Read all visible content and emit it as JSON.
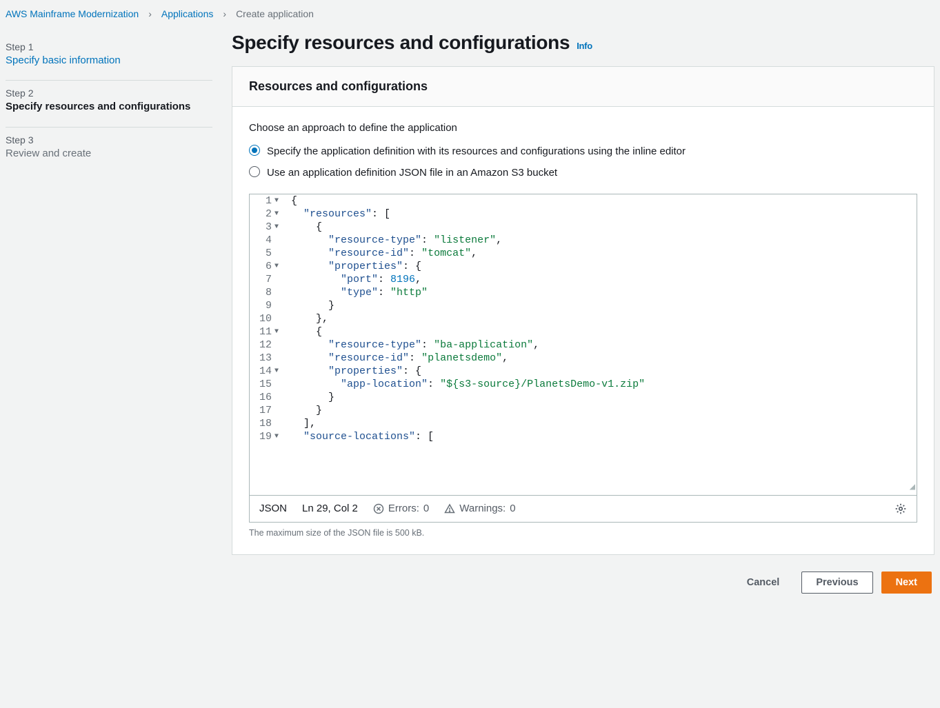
{
  "breadcrumb": {
    "items": [
      {
        "label": "AWS Mainframe Modernization",
        "link": true
      },
      {
        "label": "Applications",
        "link": true
      },
      {
        "label": "Create application",
        "link": false
      }
    ]
  },
  "sidebar": {
    "steps": [
      {
        "num": "Step 1",
        "title": "Specify basic information",
        "state": "link"
      },
      {
        "num": "Step 2",
        "title": "Specify resources and configurations",
        "state": "current"
      },
      {
        "num": "Step 3",
        "title": "Review and create",
        "state": "muted"
      }
    ]
  },
  "header": {
    "title": "Specify resources and configurations",
    "info": "Info"
  },
  "card": {
    "title": "Resources and configurations",
    "subhead": "Choose an approach to define the application",
    "option1": "Specify the application definition with its resources and configurations using the inline editor",
    "option2": "Use an application definition JSON file in an Amazon S3 bucket"
  },
  "editor": {
    "lines": [
      {
        "n": 1,
        "fold": true,
        "indent": 0,
        "tokens": [
          {
            "t": "punc",
            "v": "{"
          }
        ]
      },
      {
        "n": 2,
        "fold": true,
        "indent": 1,
        "tokens": [
          {
            "t": "key",
            "v": "\"resources\""
          },
          {
            "t": "punc",
            "v": ": ["
          }
        ]
      },
      {
        "n": 3,
        "fold": true,
        "indent": 2,
        "tokens": [
          {
            "t": "punc",
            "v": "{"
          }
        ]
      },
      {
        "n": 4,
        "fold": false,
        "indent": 3,
        "tokens": [
          {
            "t": "key",
            "v": "\"resource-type\""
          },
          {
            "t": "punc",
            "v": ": "
          },
          {
            "t": "str",
            "v": "\"listener\""
          },
          {
            "t": "punc",
            "v": ","
          }
        ]
      },
      {
        "n": 5,
        "fold": false,
        "indent": 3,
        "tokens": [
          {
            "t": "key",
            "v": "\"resource-id\""
          },
          {
            "t": "punc",
            "v": ": "
          },
          {
            "t": "str",
            "v": "\"tomcat\""
          },
          {
            "t": "punc",
            "v": ","
          }
        ]
      },
      {
        "n": 6,
        "fold": true,
        "indent": 3,
        "tokens": [
          {
            "t": "key",
            "v": "\"properties\""
          },
          {
            "t": "punc",
            "v": ": {"
          }
        ]
      },
      {
        "n": 7,
        "fold": false,
        "indent": 4,
        "tokens": [
          {
            "t": "key",
            "v": "\"port\""
          },
          {
            "t": "punc",
            "v": ": "
          },
          {
            "t": "num",
            "v": "8196"
          },
          {
            "t": "punc",
            "v": ","
          }
        ]
      },
      {
        "n": 8,
        "fold": false,
        "indent": 4,
        "tokens": [
          {
            "t": "key",
            "v": "\"type\""
          },
          {
            "t": "punc",
            "v": ": "
          },
          {
            "t": "str",
            "v": "\"http\""
          }
        ]
      },
      {
        "n": 9,
        "fold": false,
        "indent": 3,
        "tokens": [
          {
            "t": "punc",
            "v": "}"
          }
        ]
      },
      {
        "n": 10,
        "fold": false,
        "indent": 2,
        "tokens": [
          {
            "t": "punc",
            "v": "},"
          }
        ]
      },
      {
        "n": 11,
        "fold": true,
        "indent": 2,
        "tokens": [
          {
            "t": "punc",
            "v": "{"
          }
        ]
      },
      {
        "n": 12,
        "fold": false,
        "indent": 3,
        "tokens": [
          {
            "t": "key",
            "v": "\"resource-type\""
          },
          {
            "t": "punc",
            "v": ": "
          },
          {
            "t": "str",
            "v": "\"ba-application\""
          },
          {
            "t": "punc",
            "v": ","
          }
        ]
      },
      {
        "n": 13,
        "fold": false,
        "indent": 3,
        "tokens": [
          {
            "t": "key",
            "v": "\"resource-id\""
          },
          {
            "t": "punc",
            "v": ": "
          },
          {
            "t": "str",
            "v": "\"planetsdemo\""
          },
          {
            "t": "punc",
            "v": ","
          }
        ]
      },
      {
        "n": 14,
        "fold": true,
        "indent": 3,
        "tokens": [
          {
            "t": "key",
            "v": "\"properties\""
          },
          {
            "t": "punc",
            "v": ": {"
          }
        ]
      },
      {
        "n": 15,
        "fold": false,
        "indent": 4,
        "tokens": [
          {
            "t": "key",
            "v": "\"app-location\""
          },
          {
            "t": "punc",
            "v": ": "
          },
          {
            "t": "str",
            "v": "\"${s3-source}/PlanetsDemo-v1.zip\""
          }
        ]
      },
      {
        "n": 16,
        "fold": false,
        "indent": 3,
        "tokens": [
          {
            "t": "punc",
            "v": "}"
          }
        ]
      },
      {
        "n": 17,
        "fold": false,
        "indent": 2,
        "tokens": [
          {
            "t": "punc",
            "v": "}"
          }
        ]
      },
      {
        "n": 18,
        "fold": false,
        "indent": 1,
        "tokens": [
          {
            "t": "punc",
            "v": "],"
          }
        ]
      },
      {
        "n": 19,
        "fold": true,
        "indent": 1,
        "tokens": [
          {
            "t": "key",
            "v": "\"source-locations\""
          },
          {
            "t": "punc",
            "v": ": ["
          }
        ]
      }
    ],
    "status": {
      "lang": "JSON",
      "position": "Ln 29, Col 2",
      "errors_label": "Errors:",
      "errors_count": "0",
      "warnings_label": "Warnings:",
      "warnings_count": "0"
    },
    "helper": "The maximum size of the JSON file is 500 kB."
  },
  "buttons": {
    "cancel": "Cancel",
    "previous": "Previous",
    "next": "Next"
  }
}
